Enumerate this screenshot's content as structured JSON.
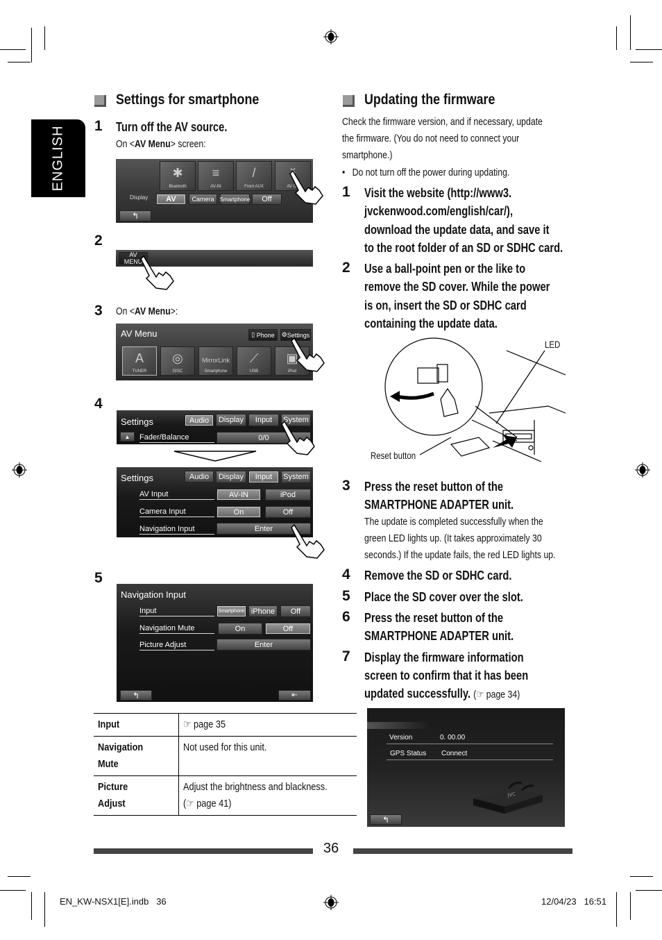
{
  "language_tab": "ENGLISH",
  "left": {
    "section_title": "Settings for smartphone",
    "steps": [
      {
        "num": "1",
        "title": "Turn off the AV source.",
        "sub_pre": "On <",
        "sub_bold": "AV Menu",
        "sub_post": "> screen:"
      },
      {
        "num": "2"
      },
      {
        "num": "3",
        "sub_pre": "On <",
        "sub_bold": "AV Menu",
        "sub_post": ">:"
      },
      {
        "num": "4"
      },
      {
        "num": "5"
      }
    ],
    "screen1": {
      "tiles": [
        "Bluetooth",
        "AV-IN",
        "Front AUX",
        "AV Off"
      ],
      "display_label": "Display",
      "display_options": [
        "AV",
        "Camera",
        "Smartphone",
        "Off"
      ],
      "selected": "AV"
    },
    "screen2": {
      "button": "AV MENU"
    },
    "screen3": {
      "title": "AV Menu",
      "phone_button": "Phone",
      "settings_button": "Settings",
      "tiles": [
        "TUNER",
        "DISC",
        "Smartphone",
        "USB",
        "iPod"
      ],
      "mirrorlink": "MirrorLink"
    },
    "screen4a": {
      "title": "Settings",
      "tabs": [
        "Audio",
        "Display",
        "Input",
        "System"
      ],
      "row_label": "Fader/Balance",
      "row_value": "0/0"
    },
    "screen4b": {
      "title": "Settings",
      "tabs": [
        "Audio",
        "Display",
        "Input",
        "System"
      ],
      "rows": [
        {
          "label": "AV Input",
          "options": [
            "AV-IN",
            "iPod"
          ]
        },
        {
          "label": "Camera Input",
          "options": [
            "On",
            "Off"
          ]
        },
        {
          "label": "Navigation Input",
          "options": [
            "Enter"
          ]
        }
      ]
    },
    "screen5": {
      "title": "Navigation Input",
      "rows": [
        {
          "label": "Input",
          "options": [
            "Smartphone",
            "iPhone",
            "Off"
          ]
        },
        {
          "label": "Navigation Mute",
          "options": [
            "On",
            "Off"
          ]
        },
        {
          "label": "Picture Adjust",
          "options": [
            "Enter"
          ]
        }
      ]
    },
    "table": [
      {
        "key": "Input",
        "value": "☞ page 35"
      },
      {
        "key": "Navigation Mute",
        "value": "Not used for this unit."
      },
      {
        "key": "Picture Adjust",
        "value": "Adjust the brightness and blackness.",
        "value2": "(☞ page 41)"
      }
    ]
  },
  "right": {
    "section_title": "Updating the firmware",
    "intro": [
      "Check the firmware version, and if necessary, update",
      "the firmware. (You do not need to connect your",
      "smartphone.)"
    ],
    "bullet": "Do not turn off the power during updating.",
    "steps": [
      {
        "num": "1",
        "lines": [
          "Visit the website (http://www3.",
          "jvckenwood.com/english/car/),",
          "download the update data, and save it",
          "to the root folder of an SD or SDHC card."
        ]
      },
      {
        "num": "2",
        "lines": [
          "Use a ball-point pen or the like to",
          "remove the SD cover. While the power",
          "is on, insert the SD or SDHC card",
          "containing the update data."
        ]
      },
      {
        "num": "3",
        "lines": [
          "Press the reset button of the",
          "SMARTPHONE ADAPTER unit."
        ],
        "detail": [
          "The update is completed successfully when the",
          "green LED lights up. (It takes approximately 30",
          "seconds.) If the update fails, the red LED lights up."
        ]
      },
      {
        "num": "4",
        "lines": [
          "Remove the SD or SDHC card."
        ]
      },
      {
        "num": "5",
        "lines": [
          "Place the SD cover over the slot."
        ]
      },
      {
        "num": "6",
        "lines": [
          "Press the reset button of the",
          "SMARTPHONE ADAPTER unit."
        ]
      },
      {
        "num": "7",
        "lines": [
          "Display the firmware information",
          "screen to confirm that it has been",
          "updated successfully."
        ],
        "ref": "(☞ page 34)"
      }
    ],
    "diagram": {
      "led_label": "LED",
      "reset_label": "Reset button"
    },
    "firmware_screen": {
      "version_label": "Version",
      "version_value": "0. 00.00",
      "gps_label": "GPS Status",
      "gps_value": "Connect",
      "brand": "JVC"
    }
  },
  "page_number": "36",
  "footer": {
    "file": "EN_KW-NSX1[E].indb   36",
    "date": "12/04/23   16:51"
  }
}
